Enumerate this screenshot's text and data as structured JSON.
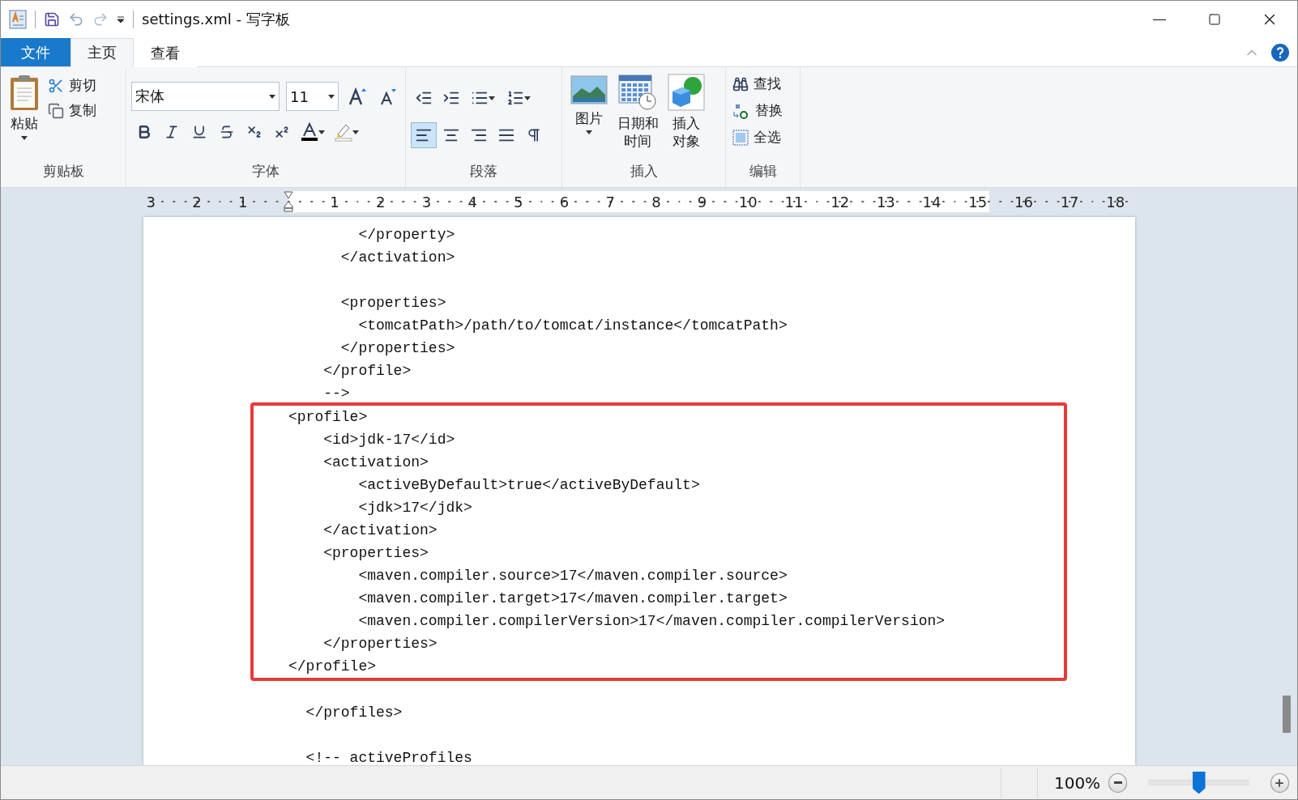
{
  "window": {
    "title": "settings.xml - 写字板"
  },
  "ribbon": {
    "file_tab": "文件",
    "tabs": [
      {
        "label": "主页",
        "selected": true
      },
      {
        "label": "查看",
        "selected": false
      }
    ],
    "clipboard": {
      "label": "剪贴板",
      "paste": "粘贴",
      "cut": "剪切",
      "copy": "复制"
    },
    "font": {
      "label": "字体",
      "font_name": "宋体",
      "font_size": "11"
    },
    "paragraph": {
      "label": "段落",
      "alignments": [
        {
          "kind": "left",
          "selected": true
        },
        {
          "kind": "center",
          "selected": false
        },
        {
          "kind": "right",
          "selected": false
        },
        {
          "kind": "justify",
          "selected": false
        }
      ]
    },
    "insert": {
      "label": "插入",
      "items": [
        {
          "kind": "picture",
          "label": "图片"
        },
        {
          "kind": "datetime",
          "label": "日期和时间"
        },
        {
          "kind": "object",
          "label": "插入对象"
        }
      ]
    },
    "edit": {
      "label": "编辑",
      "items": [
        {
          "kind": "find",
          "label": "查找"
        },
        {
          "kind": "replace",
          "label": "替换"
        },
        {
          "kind": "select_all",
          "label": "全选"
        }
      ]
    }
  },
  "ruler": {
    "left_labels": [
      "3",
      "2",
      "1"
    ],
    "right_labels": [
      "1",
      "2",
      "3",
      "4",
      "5",
      "6",
      "7",
      "8",
      "9",
      "10",
      "11",
      "12",
      "13",
      "14",
      "15",
      "16",
      "17",
      "18"
    ]
  },
  "document": {
    "paragraphs_before": [
      [
        "        </property>",
        "      </activation>"
      ],
      [
        "      <properties>",
        "        <tomcatPath>/path/to/tomcat/instance</tomcatPath>",
        "      </properties>",
        "    </profile>",
        "    -->"
      ]
    ],
    "highlighted_lines": [
      "<profile>",
      "    <id>jdk-17</id>",
      "    <activation>",
      "        <activeByDefault>true</activeByDefault>",
      "        <jdk>17</jdk>",
      "    </activation>",
      "    <properties>",
      "        <maven.compiler.source>17</maven.compiler.source>",
      "        <maven.compiler.target>17</maven.compiler.target>",
      "        <maven.compiler.compilerVersion>17</maven.compiler.compilerVersion>",
      "    </properties>",
      "</profile>"
    ],
    "paragraphs_after": [
      [
        "  </profiles>"
      ],
      [
        "  <!-- activeProfiles"
      ]
    ]
  },
  "status_bar": {
    "zoom": "100%",
    "zoom_slider": {
      "level": 0.5
    }
  }
}
